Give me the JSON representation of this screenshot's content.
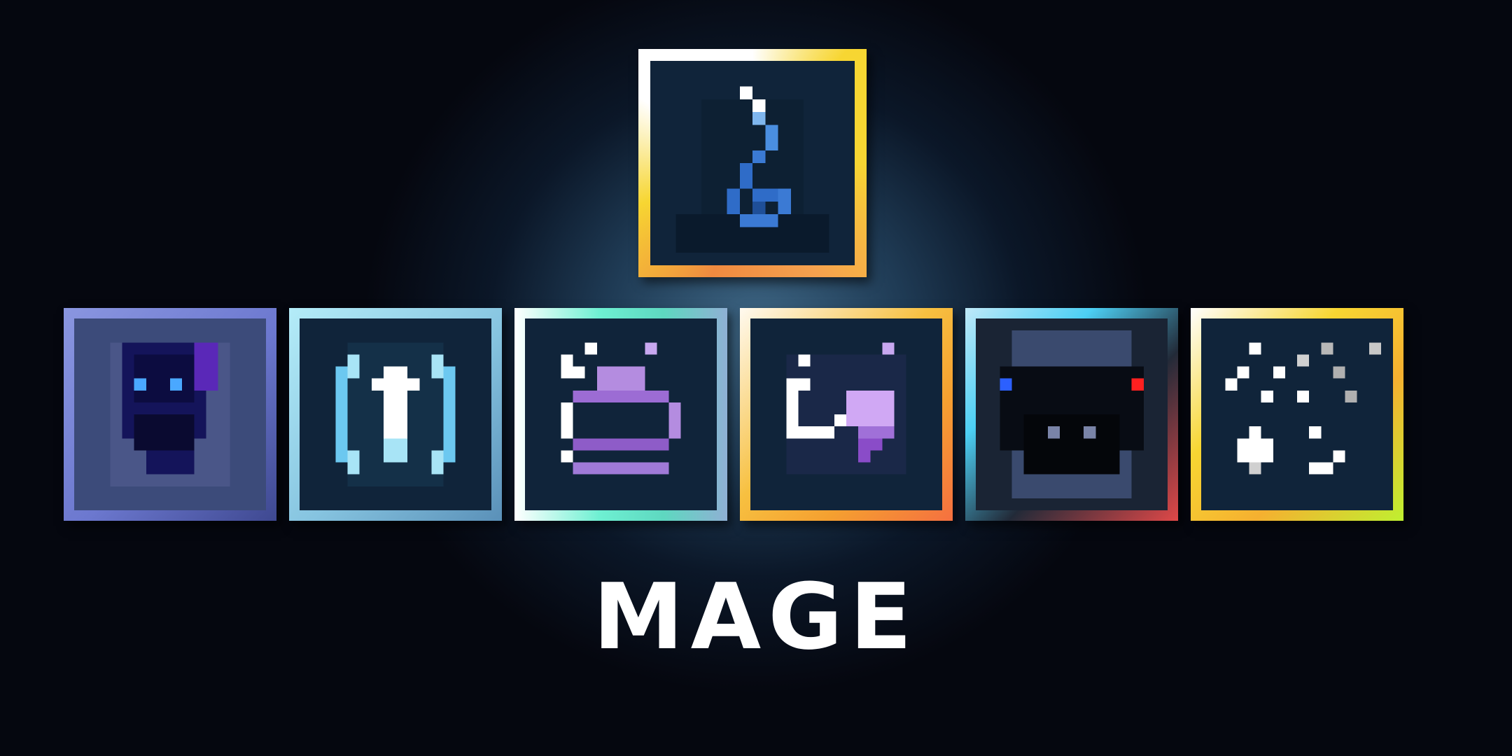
{
  "class_name": "MAGE",
  "featured_icon": {
    "name": "serpent-spiral-icon",
    "frame": [
      "#ffffff",
      "#f7d632",
      "#f5a14e",
      "#ef8a40"
    ]
  },
  "ability_icons": [
    {
      "name": "shadow-specter-icon",
      "frame": [
        "#8a96e0",
        "#6c78cf",
        "#4b559e"
      ]
    },
    {
      "name": "ice-shield-arrow-icon",
      "frame": [
        "#a8e4f6",
        "#86c4e0",
        "#5f98bc"
      ]
    },
    {
      "name": "purple-crown-icon",
      "frame": [
        "#ffffff",
        "#6ef0d2",
        "#5ed8c0",
        "#8fb0d4"
      ]
    },
    {
      "name": "moon-heart-icon",
      "frame": [
        "#fffaf0",
        "#f7c040",
        "#f5a030",
        "#f58040"
      ]
    },
    {
      "name": "red-eyed-shadow-icon",
      "frame": [
        "#bfe9f8",
        "#4ccff4",
        "#222a38",
        "#e04848"
      ]
    },
    {
      "name": "shooting-stars-icon",
      "frame": [
        "#ffffff",
        "#f7d632",
        "#f5b030",
        "#bff030"
      ]
    }
  ]
}
